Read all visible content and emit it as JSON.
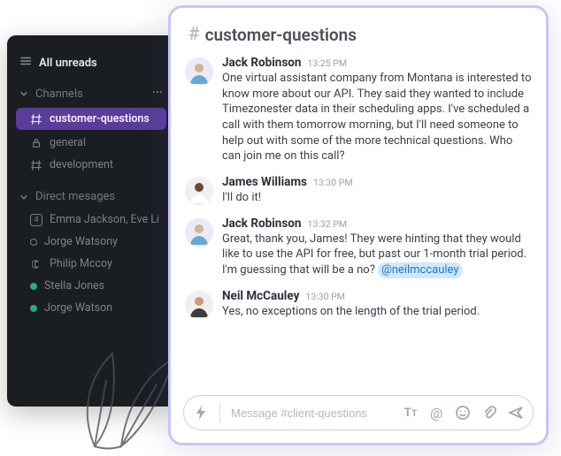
{
  "sidebar": {
    "all_unreads": "All unreads",
    "channels_label": "Channels",
    "channels": [
      {
        "label": "customer-questions",
        "icon": "hash",
        "active": true
      },
      {
        "label": "general",
        "icon": "lock",
        "active": false
      },
      {
        "label": "development",
        "icon": "hash",
        "active": false
      }
    ],
    "dm_label": "Direct mesages",
    "dms": [
      {
        "label": "Emma Jackson, Eve Li",
        "badge": "4",
        "status": ""
      },
      {
        "label": "Jorge Watsony",
        "status": "away"
      },
      {
        "label": "Philip Mccoy",
        "status": "moon"
      },
      {
        "label": "Stella Jones",
        "status": "on"
      },
      {
        "label": "Jorge Watson",
        "status": "on"
      }
    ]
  },
  "channel_name": "customer-questions",
  "messages": [
    {
      "name": "Jack Robinson",
      "time": "13:25 PM",
      "text": "One virtual assistant company from Montana is interested to know more about our API. They said they wanted to include Timezonester data in their scheduling apps. I've scheduled a call with them tomorrow morning, but I'll need someone to help out with some of the more technical questions. Who can join me on this call?"
    },
    {
      "name": "James Williams",
      "time": "13:30 PM",
      "text": "I'll do it!"
    },
    {
      "name": "Jack Robinson",
      "time": "13:32 PM",
      "text": "Great, thank you, James! They were hinting that they would like to use the API for free, but past our 1-month trial period. I'm guessing that will be a no? ",
      "mention": "@neilmccauley"
    },
    {
      "name": "Neil McCauley",
      "time": "13:30 PM",
      "text": "Yes, no exceptions on the length of the trial period."
    }
  ],
  "composer": {
    "placeholder": "Message #client-questions"
  },
  "colors": {
    "accent": "#5a3d99",
    "card_border": "#c8c6f6",
    "mention_bg": "#cfe8ff"
  }
}
